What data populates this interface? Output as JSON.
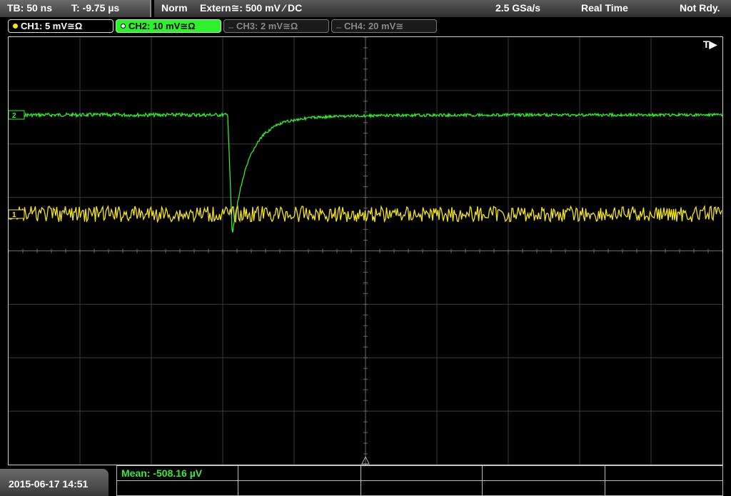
{
  "header": {
    "timebase": "TB: 50 ns",
    "trigger_time": "T: -9.75 µs",
    "trigger_mode": "Norm",
    "trigger_source": "Extern≅: 500 mV ⁄ DC",
    "sample_rate": "2.5 GSa/s",
    "acq_mode": "Real Time",
    "status": "Not Rdy."
  },
  "channels": [
    {
      "id": "ch1",
      "label": "CH1: 5 mV≅Ω",
      "color": "#f5e51a",
      "active": true
    },
    {
      "id": "ch2",
      "label": "CH2: 10 mV≅Ω",
      "color": "#2ef02e",
      "active": true
    },
    {
      "id": "ch3",
      "label": "CH3: 2 mV≅Ω",
      "color": "#777777",
      "active": false
    },
    {
      "id": "ch4",
      "label": "CH4: 20 mV≅",
      "color": "#777777",
      "active": false
    }
  ],
  "screen": {
    "trigger_marker": "T▶",
    "ch1_marker": "1",
    "ch2_marker": "2",
    "trace_colors": {
      "ch1": "#f5e51a",
      "ch2": "#2ef02e"
    }
  },
  "footer": {
    "datetime": "2015-06-17 14:51",
    "measurement": "Mean: -508.16 µV"
  }
}
